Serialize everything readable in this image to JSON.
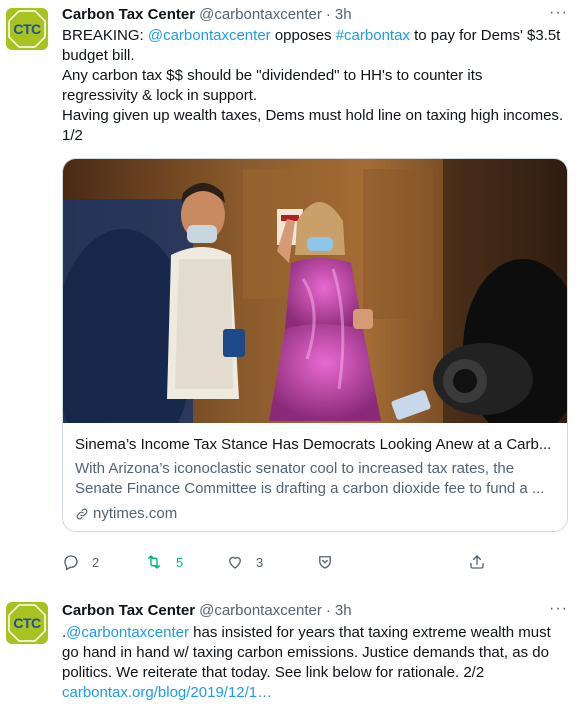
{
  "tweets": [
    {
      "avatar_text": "CTC",
      "name": "Carbon Tax Center",
      "handle": "@carbontaxcenter",
      "separator": "·",
      "time": "3h",
      "more": "···",
      "text_parts": {
        "l1_a": "BREAKING: ",
        "l1_link1": "@carbontaxcenter",
        "l1_b": " opposes ",
        "l1_link2": "#carbontax",
        "l1_c": " to pay for Dems' $3.5t",
        "l2": "budget bill.",
        "l3": "Any carbon tax $$ should be \"dividended\" to HH's to counter its",
        "l4": "regressivity & lock in support.",
        "l5": "Having given up wealth taxes, Dems must hold line on taxing high incomes.",
        "l6": "1/2"
      },
      "card": {
        "title": "Sinema’s Income Tax Stance Has Democrats Looking Anew at a Carb...",
        "description": "With Arizona’s iconoclastic senator cool to increased tax rates, the Senate Finance Committee is drafting a carbon dioxide fee to fund a ...",
        "domain": "nytimes.com"
      },
      "actions": {
        "replies": "2",
        "retweets": "5",
        "likes": "3"
      }
    },
    {
      "avatar_text": "CTC",
      "name": "Carbon Tax Center",
      "handle": "@carbontaxcenter",
      "separator": "·",
      "time": "3h",
      "more": "···",
      "text_parts": {
        "l1_a": ".",
        "l1_link": "@carbontaxcenter",
        "l1_b": " has insisted for years that taxing extreme wealth must",
        "l2": "go hand in hand w/ taxing carbon emissions. Justice demands that, as do",
        "l3": "politics. We reiterate that today. See link below for rationale. 2/2",
        "l4_link": "carbontax.org/blog/2019/12/1…"
      }
    }
  ],
  "colors": {
    "accent": "#1d9bf0",
    "retweet_green": "#00ba7c",
    "secondary_text": "#536471",
    "avatar_green": "#a8c21f",
    "avatar_text_blue": "#1f4fa3"
  }
}
